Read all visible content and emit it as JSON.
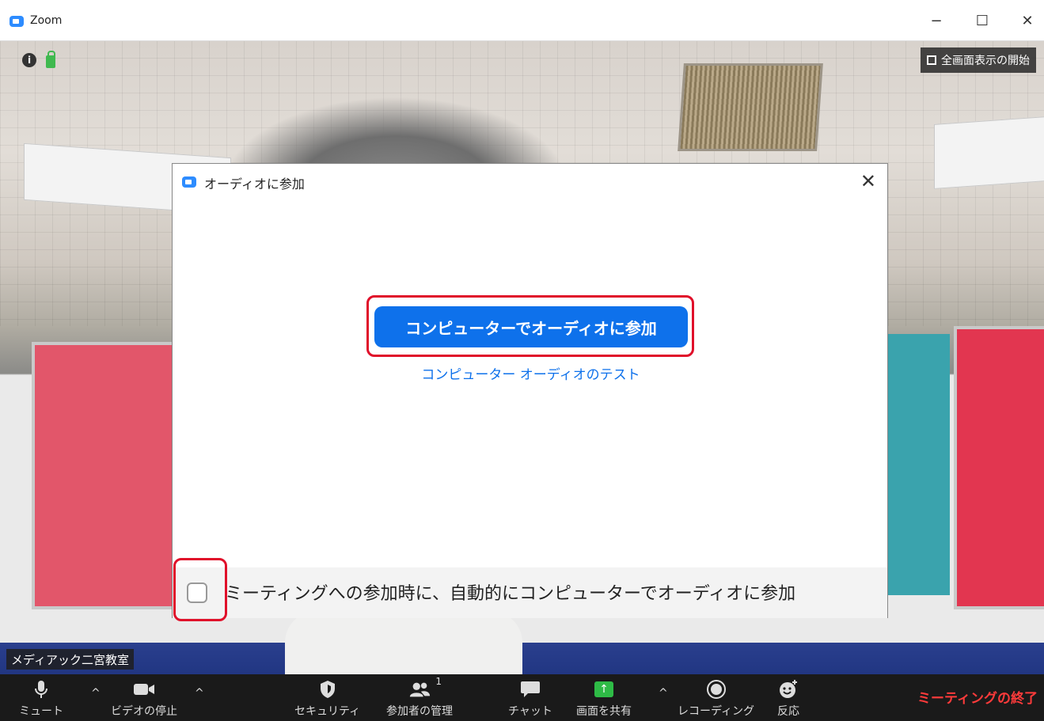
{
  "window": {
    "title": "Zoom",
    "minimize": "−",
    "maximize": "☐",
    "close": "✕"
  },
  "video": {
    "fullscreen_label": "全画面表示の開始",
    "participant_name": "メディアック二宮教室",
    "info_icon": "i"
  },
  "dialog": {
    "title": "オーディオに参加",
    "close": "✕",
    "join_button": "コンピューターでオーディオに参加",
    "test_link": "コンピューター オーディオのテスト",
    "auto_join_label": "ミーティングへの参加時に、自動的にコンピューターでオーディオに参加",
    "auto_join_checked": false,
    "highlight_color": "#e0102a",
    "button_color": "#0e71eb"
  },
  "toolbar": {
    "mute": "ミュート",
    "video_stop": "ビデオの停止",
    "security": "セキュリティ",
    "participants": "参加者の管理",
    "participants_count": "1",
    "chat": "チャット",
    "share": "画面を共有",
    "recording": "レコーディング",
    "reactions": "反応",
    "end": "ミーティングの終了",
    "caret": "^"
  }
}
